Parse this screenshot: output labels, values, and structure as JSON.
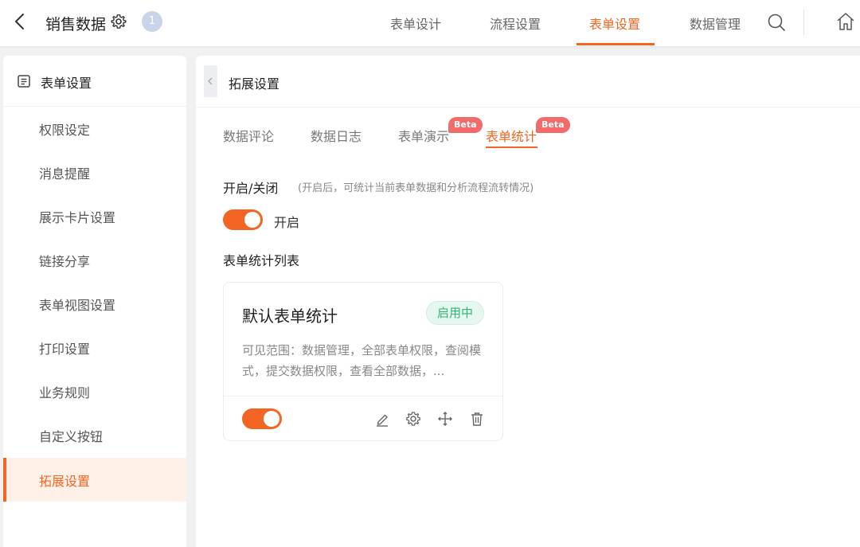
{
  "header": {
    "title": "销售数据",
    "badge_count": "1",
    "tabs": [
      {
        "label": "表单设计"
      },
      {
        "label": "流程设置"
      },
      {
        "label": "表单设置"
      },
      {
        "label": "数据管理"
      }
    ],
    "active_tab": "表单设置",
    "accent_color": "#f26522"
  },
  "sidebar": {
    "header_label": "表单设置",
    "items": [
      {
        "label": "权限设定"
      },
      {
        "label": "消息提醒"
      },
      {
        "label": "展示卡片设置"
      },
      {
        "label": "链接分享"
      },
      {
        "label": "表单视图设置"
      },
      {
        "label": "打印设置"
      },
      {
        "label": "业务规则"
      },
      {
        "label": "自定义按钮"
      },
      {
        "label": "拓展设置"
      }
    ],
    "active_item": "拓展设置"
  },
  "main": {
    "title": "拓展设置",
    "subtabs": [
      {
        "label": "数据评论",
        "beta": ""
      },
      {
        "label": "数据日志",
        "beta": ""
      },
      {
        "label": "表单演示",
        "beta": "Beta"
      },
      {
        "label": "表单统计",
        "beta": "Beta"
      }
    ],
    "active_subtab": "表单统计",
    "toggle_section": {
      "label": "开启/关闭",
      "hint": "(开启后，可统计当前表单数据和分析流程流转情况)",
      "state_label": "开启",
      "enabled": true
    },
    "list_label": "表单统计列表",
    "card": {
      "title": "默认表单统计",
      "status": "启用中",
      "description": "可见范围：数据管理，全部表单权限，查阅模式，提交数据权限，查看全部数据，...",
      "enabled": true
    }
  },
  "icons": {
    "back": "back-arrow-icon",
    "settings": "gear-icon",
    "search": "search-icon",
    "home": "home-icon",
    "form": "form-list-icon",
    "edit": "edit-icon",
    "move": "move-icon",
    "delete": "trash-icon",
    "collapse": "chevron-left-icon"
  }
}
